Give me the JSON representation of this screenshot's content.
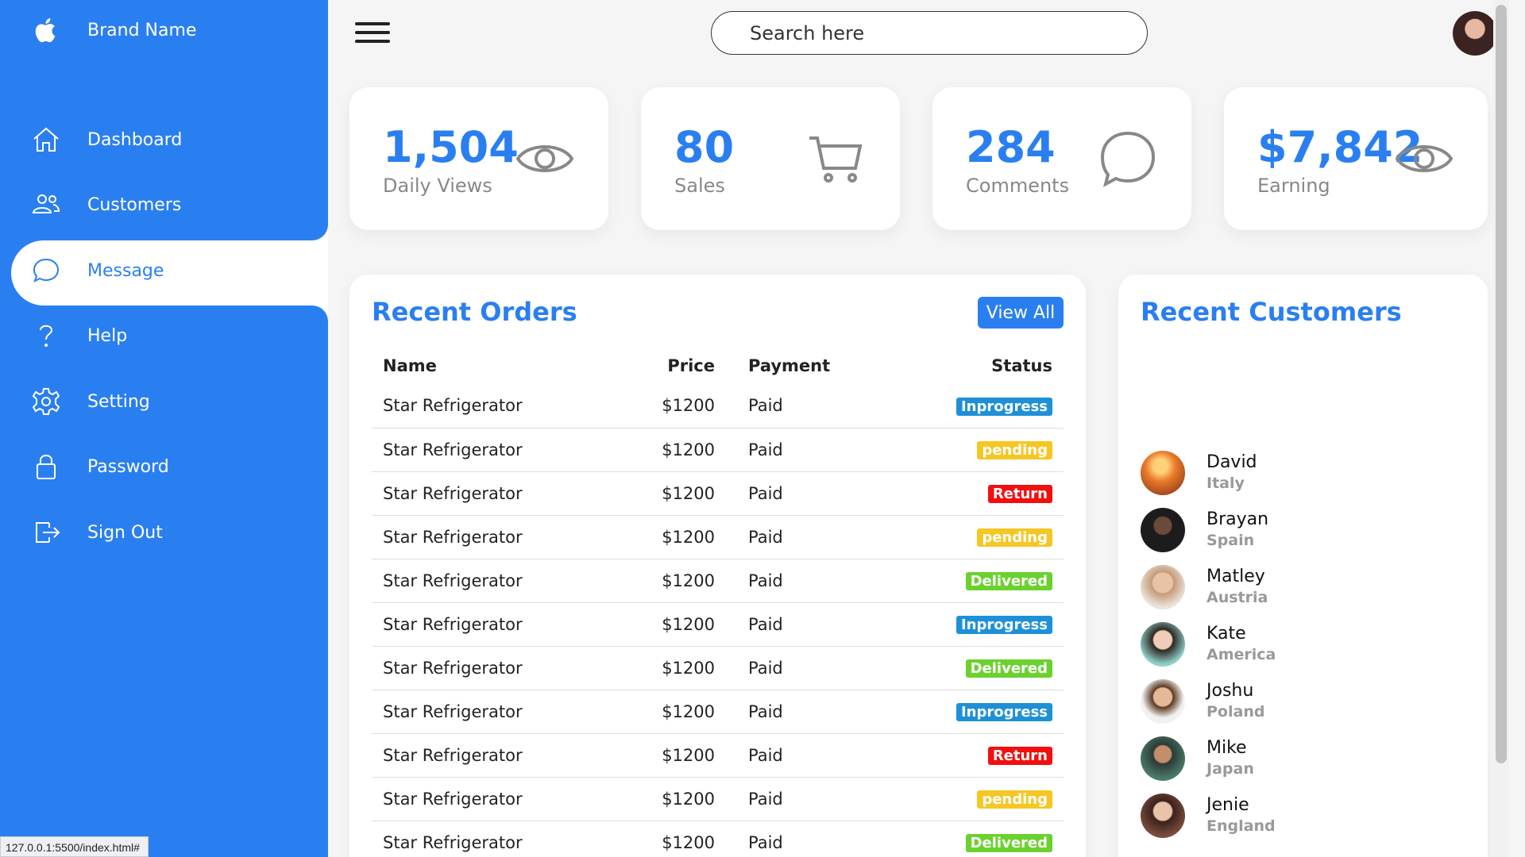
{
  "brand": {
    "name": "Brand Name",
    "icon": "apple-icon"
  },
  "sidebar": {
    "items": [
      {
        "label": "Dashboard",
        "icon": "home-icon"
      },
      {
        "label": "Customers",
        "icon": "people-icon"
      },
      {
        "label": "Message",
        "icon": "chat-icon",
        "active": true
      },
      {
        "label": "Help",
        "icon": "help-icon"
      },
      {
        "label": "Setting",
        "icon": "gear-icon"
      },
      {
        "label": "Password",
        "icon": "lock-icon"
      },
      {
        "label": "Sign Out",
        "icon": "sign-out-icon"
      }
    ]
  },
  "status_url": "127.0.0.1:5500/index.html#",
  "search": {
    "placeholder": "Search here"
  },
  "cards": [
    {
      "value": "1,504",
      "label": "Daily Views",
      "icon": "eye-icon"
    },
    {
      "value": "80",
      "label": "Sales",
      "icon": "cart-icon"
    },
    {
      "value": "284",
      "label": "Comments",
      "icon": "chat-icon"
    },
    {
      "value": "$7,842",
      "label": "Earning",
      "icon": "eye-icon"
    }
  ],
  "orders": {
    "title": "Recent Orders",
    "view_all": "View All",
    "columns": [
      "Name",
      "Price",
      "Payment",
      "Status"
    ],
    "rows": [
      {
        "name": "Star Refrigerator",
        "price": "$1200",
        "payment": "Paid",
        "status": "Inprogress"
      },
      {
        "name": "Star Refrigerator",
        "price": "$1200",
        "payment": "Paid",
        "status": "pending"
      },
      {
        "name": "Star Refrigerator",
        "price": "$1200",
        "payment": "Paid",
        "status": "Return"
      },
      {
        "name": "Star Refrigerator",
        "price": "$1200",
        "payment": "Paid",
        "status": "pending"
      },
      {
        "name": "Star Refrigerator",
        "price": "$1200",
        "payment": "Paid",
        "status": "Delivered"
      },
      {
        "name": "Star Refrigerator",
        "price": "$1200",
        "payment": "Paid",
        "status": "Inprogress"
      },
      {
        "name": "Star Refrigerator",
        "price": "$1200",
        "payment": "Paid",
        "status": "Delivered"
      },
      {
        "name": "Star Refrigerator",
        "price": "$1200",
        "payment": "Paid",
        "status": "Inprogress"
      },
      {
        "name": "Star Refrigerator",
        "price": "$1200",
        "payment": "Paid",
        "status": "Return"
      },
      {
        "name": "Star Refrigerator",
        "price": "$1200",
        "payment": "Paid",
        "status": "pending"
      },
      {
        "name": "Star Refrigerator",
        "price": "$1200",
        "payment": "Paid",
        "status": "Delivered"
      }
    ]
  },
  "customers": {
    "title": "Recent Customers",
    "list": [
      {
        "name": "David",
        "country": "Italy"
      },
      {
        "name": "Brayan",
        "country": "Spain"
      },
      {
        "name": "Matley",
        "country": "Austria"
      },
      {
        "name": "Kate",
        "country": "America"
      },
      {
        "name": "Joshu",
        "country": "Poland"
      },
      {
        "name": "Mike",
        "country": "Japan"
      },
      {
        "name": "Jenie",
        "country": "England"
      }
    ]
  },
  "colors": {
    "accent": "#2a7ff0",
    "inprogress": "#1e90d8",
    "pending": "#f6c623",
    "return": "#f20f0f",
    "delivered": "#6bd12f"
  }
}
